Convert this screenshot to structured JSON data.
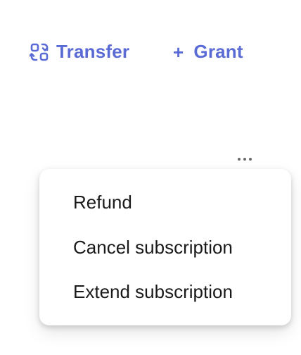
{
  "actions": {
    "transfer": {
      "label": "Transfer",
      "icon": "transfer-icon"
    },
    "grant": {
      "label": "Grant",
      "icon": "plus-icon",
      "icon_glyph": "+"
    }
  },
  "more": {
    "icon": "more-horizontal-icon"
  },
  "menu": {
    "items": [
      {
        "label": "Refund"
      },
      {
        "label": "Cancel subscription"
      },
      {
        "label": "Extend subscription"
      }
    ]
  },
  "colors": {
    "accent": "#5b6bd6",
    "menu_text": "#1a1a1a",
    "more_dots": "#6b6b6b"
  }
}
